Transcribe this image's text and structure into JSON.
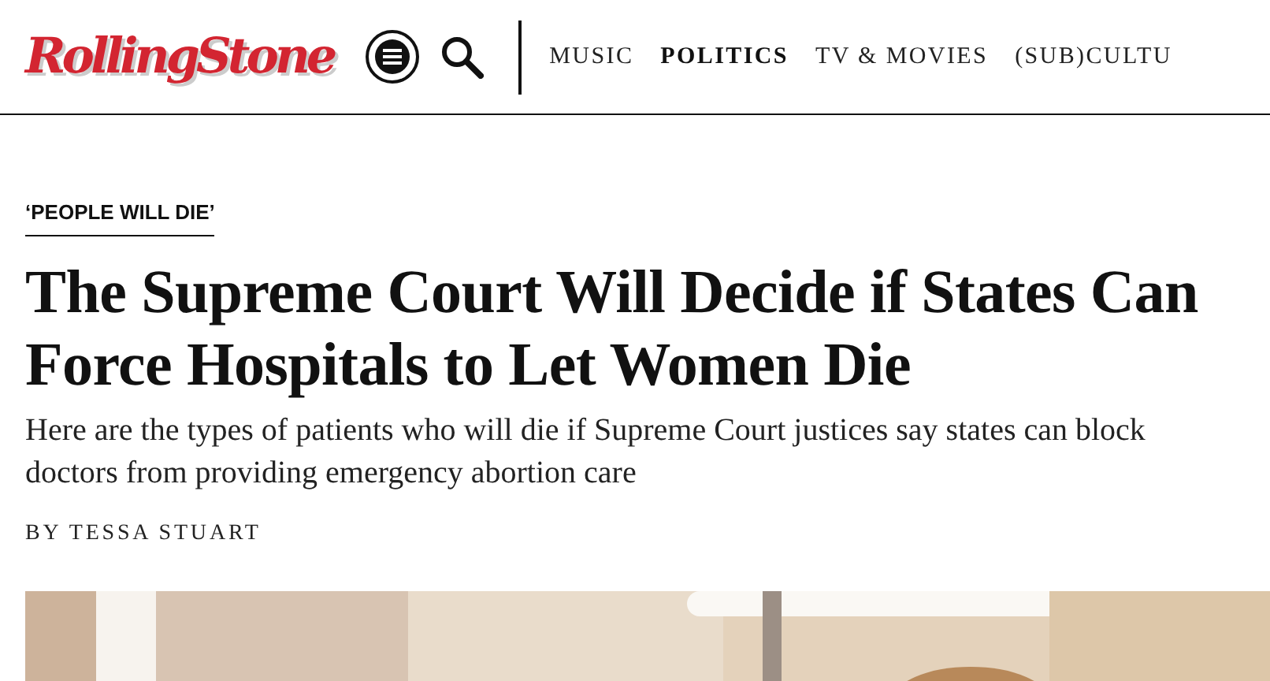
{
  "header": {
    "logo": "RollingStone",
    "nav": [
      {
        "label": "MUSIC",
        "selected": false
      },
      {
        "label": "POLITICS",
        "selected": true
      },
      {
        "label": "TV & MOVIES",
        "selected": false
      },
      {
        "label": "(SUB)CULTU",
        "selected": false
      }
    ]
  },
  "article": {
    "kicker": "‘PEOPLE WILL DIE’",
    "headline": "The Supreme Court Will Decide if States Can Force Hospitals to Let Women Die",
    "dek": "Here are the types of patients who will die if Supreme Court justices say states can block doctors from providing emergency abortion care",
    "byline": "BY TESSA STUART"
  }
}
